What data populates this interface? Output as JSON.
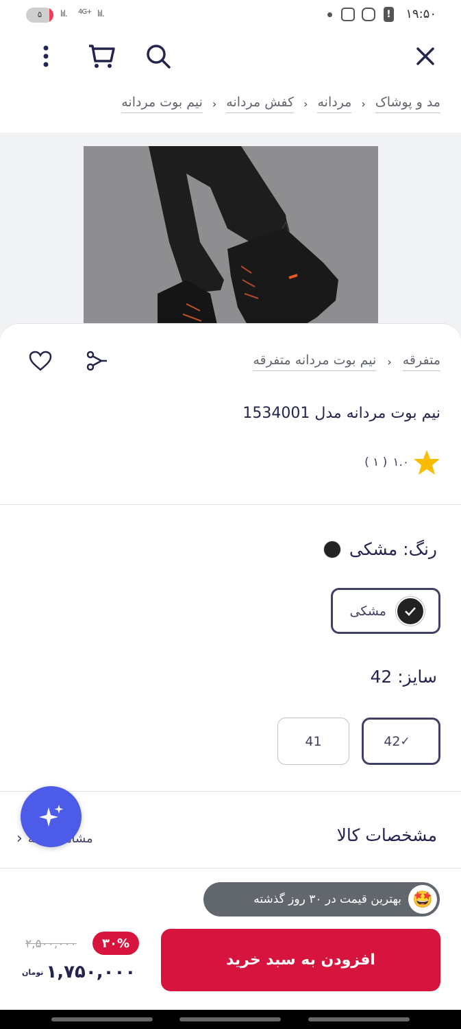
{
  "status_bar": {
    "time": "۱۹:۵۰",
    "battery": "۵",
    "network": "4G+"
  },
  "top_bar": {
    "icons": [
      "close-icon",
      "search-icon",
      "cart-icon",
      "more-vertical-icon"
    ]
  },
  "breadcrumb": [
    "مد و پوشاک",
    "مردانه",
    "کفش مردانه",
    "نیم بوت مردانه"
  ],
  "product": {
    "sub_breadcrumb": [
      "متفرقه",
      "نیم بوت مردانه متفرقه"
    ],
    "title": "نیم بوت مردانه مدل 1534001",
    "rating": "۱.۰",
    "rating_count": "( ۱ )"
  },
  "color": {
    "label": "رنگ: مشکی",
    "options": [
      {
        "label": "مشکی",
        "hex": "#222222",
        "selected": true
      }
    ]
  },
  "size": {
    "label": "سایز: 42",
    "options": [
      {
        "label": "42",
        "selected": true
      },
      {
        "label": "41",
        "selected": false
      }
    ]
  },
  "specs": {
    "title": "مشخصات کالا",
    "link": "مشاهده همه"
  },
  "bottom": {
    "best_price_badge": "بهترین قیمت در ۳۰ روز گذشته",
    "add_to_cart": "افزودن به سبد خرید",
    "old_price": "۲,۵۰۰,۰۰۰",
    "discount": "۳۰%",
    "price": "۱,۷۵۰,۰۰۰",
    "currency": "تومان"
  },
  "colors": {
    "primary": "#d7143d",
    "text": "#23254e",
    "fab": "#4d5ce8"
  }
}
